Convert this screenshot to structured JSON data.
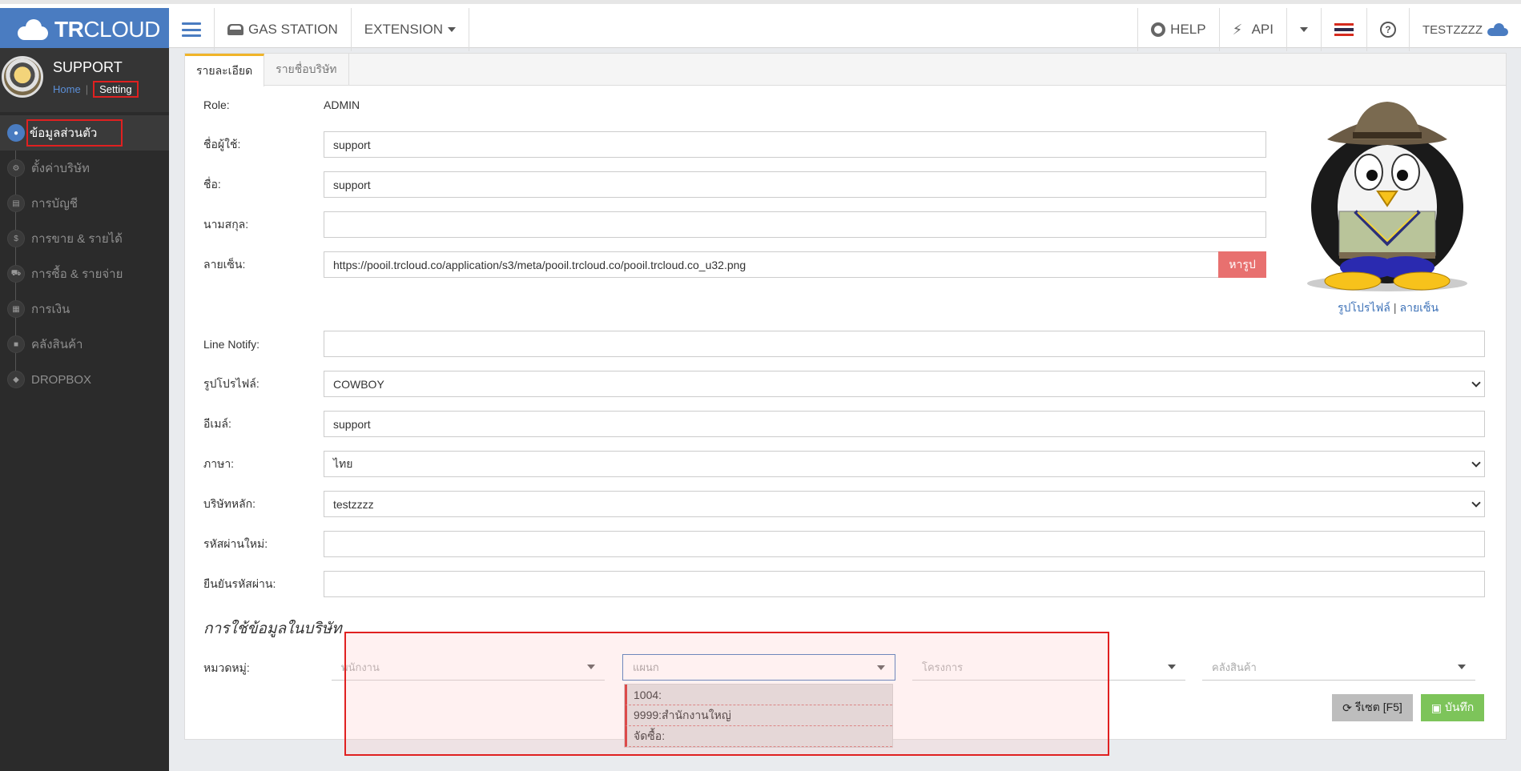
{
  "brand": {
    "name_bold": "TR",
    "name_rest": "CLOUD"
  },
  "topnav": {
    "station": "GAS STATION",
    "extension": "EXTENSION"
  },
  "topright": {
    "help": "HELP",
    "api": "API",
    "user": "TESTZZZZ"
  },
  "colors": {
    "brand_blue": "#4a7cc1",
    "danger": "#e8706f",
    "success": "#7dc45a",
    "highlight": "#e02020"
  },
  "profile": {
    "name": "SUPPORT",
    "crumb_home": "Home",
    "crumb_setting": "Setting"
  },
  "sidebar": {
    "items": [
      {
        "label": "ข้อมูลส่วนตัว",
        "icon": "user-icon"
      },
      {
        "label": "ตั้งค่าบริษัท",
        "icon": "gear-icon"
      },
      {
        "label": "การบัญชี",
        "icon": "book-icon"
      },
      {
        "label": "การขาย & รายได้",
        "icon": "dollar-icon"
      },
      {
        "label": "การซื้อ & รายจ่าย",
        "icon": "cart-icon"
      },
      {
        "label": "การเงิน",
        "icon": "calendar-icon"
      },
      {
        "label": "คลังสินค้า",
        "icon": "truck-icon"
      },
      {
        "label": "DROPBOX",
        "icon": "dropbox-icon"
      }
    ]
  },
  "tabs": [
    "รายละเอียด",
    "รายชื่อบริษัท"
  ],
  "form": {
    "role_label": "Role:",
    "role_value": "ADMIN",
    "username_label": "ชื่อผู้ใช้:",
    "username_value": "support",
    "firstname_label": "ชื่อ:",
    "firstname_value": "support",
    "lastname_label": "นามสกุล:",
    "lastname_value": "",
    "signature_label": "ลายเซ็น:",
    "signature_value": "https://pooil.trcloud.co/application/s3/meta/pooil.trcloud.co/pooil.trcloud.co_u32.png",
    "find_image_button": "หารูป",
    "line_label": "Line Notify:",
    "line_value": "",
    "avatar_label": "รูปโปรไฟล์:",
    "avatar_value": "COWBOY",
    "email_label": "อีเมล์:",
    "email_value": "support",
    "language_label": "ภาษา:",
    "language_value": "ไทย",
    "company_label": "บริษัทหลัก:",
    "company_value": "testzzzz",
    "newpass_label": "รหัสผ่านใหม่:",
    "newpass_value": "",
    "confirmpass_label": "ยืนยันรหัสผ่าน:",
    "confirmpass_value": ""
  },
  "picture_links": {
    "profile": "รูปโปรไฟล์",
    "sep": "|",
    "signature": "ลายเซ็น"
  },
  "company_section": {
    "title": "การใช้ข้อมูลในบริษัท",
    "category_label": "หมวดหมู่:",
    "combo_employee": "พนักงาน",
    "combo_department": "แผนก",
    "combo_project": "โครงการ",
    "combo_warehouse": "คลังสินค้า",
    "dropdown_options": [
      "1004:",
      "9999:สำนักงานใหญ่",
      "จัดซื้อ:"
    ]
  },
  "actions": {
    "reset": "รีเซต [F5]",
    "save": "บันทึก"
  }
}
